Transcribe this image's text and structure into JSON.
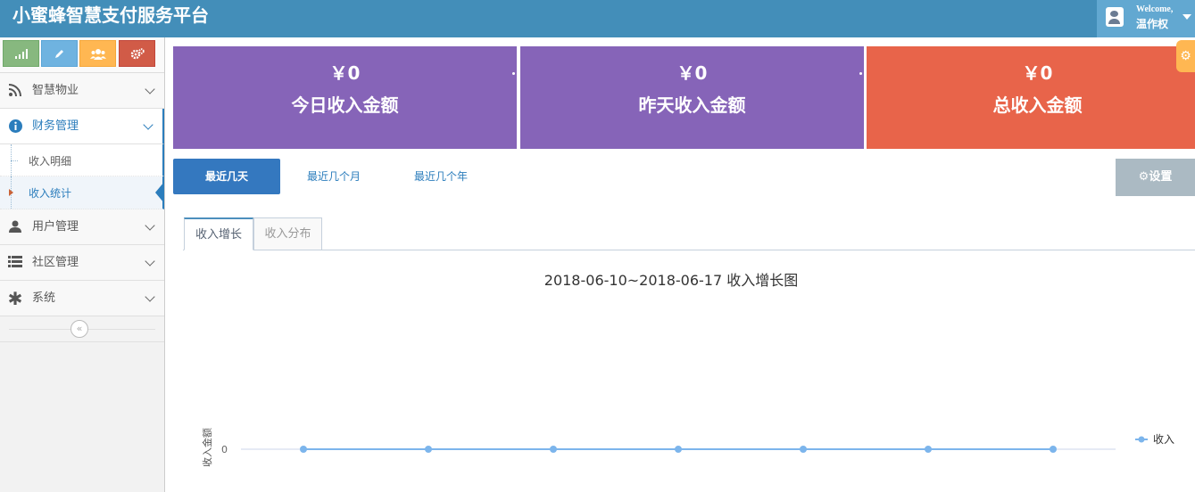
{
  "navbar": {
    "brand": "小蜜蜂智慧支付服务平台",
    "welcome": "Welcome,",
    "username": "温作权",
    "bg_color": "#438eb9"
  },
  "sidebar": {
    "shortcuts": [
      {
        "icon": "signal-icon",
        "color": "#87b87f"
      },
      {
        "icon": "pencil-icon",
        "color": "#6fb3e0"
      },
      {
        "icon": "users-icon",
        "color": "#ffb752"
      },
      {
        "icon": "cogs-icon",
        "color": "#d15b47"
      }
    ],
    "items": [
      {
        "label": "智慧物业",
        "icon": "rss-icon"
      },
      {
        "label": "财务管理",
        "icon": "info-circle-icon",
        "open": true,
        "children": [
          {
            "label": "收入明细"
          },
          {
            "label": "收入统计",
            "active": true
          }
        ]
      },
      {
        "label": "用户管理",
        "icon": "user-icon"
      },
      {
        "label": "社区管理",
        "icon": "list-icon"
      },
      {
        "label": "系统",
        "icon": "asterisk-icon"
      }
    ],
    "collapse_icon": "double-angle-left-icon"
  },
  "stats": [
    {
      "value": "￥0",
      "label": "今日收入金额",
      "color": "#8664b8"
    },
    {
      "value": "￥0",
      "label": "昨天收入金额",
      "color": "#8664b8"
    },
    {
      "value": "￥0",
      "label": "总收入金额",
      "color": "#e8644a"
    }
  ],
  "period_buttons": [
    "最近几天",
    "最近几个月",
    "最近几个年"
  ],
  "settings_label": "⚙设置",
  "tabs": [
    "收入增长",
    "收入分布"
  ],
  "chart_data": {
    "type": "line",
    "title": "2018-06-10~2018-06-17 收入增长图",
    "ylabel": "收入金额",
    "y_ticks": [
      "0"
    ],
    "series": [
      {
        "name": "收入",
        "values": [
          0,
          0,
          0,
          0,
          0,
          0,
          0
        ],
        "color": "#7cb5ec"
      }
    ]
  }
}
